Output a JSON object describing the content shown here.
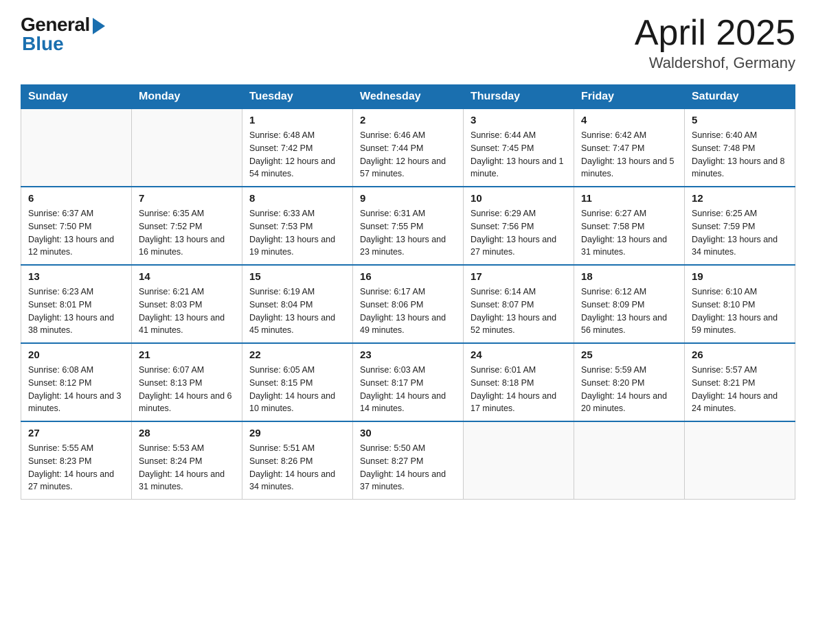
{
  "header": {
    "logo_general": "General",
    "logo_blue": "Blue",
    "title": "April 2025",
    "location": "Waldershof, Germany"
  },
  "weekdays": [
    "Sunday",
    "Monday",
    "Tuesday",
    "Wednesday",
    "Thursday",
    "Friday",
    "Saturday"
  ],
  "weeks": [
    [
      {
        "day": "",
        "sunrise": "",
        "sunset": "",
        "daylight": "",
        "empty": true
      },
      {
        "day": "",
        "sunrise": "",
        "sunset": "",
        "daylight": "",
        "empty": true
      },
      {
        "day": "1",
        "sunrise": "Sunrise: 6:48 AM",
        "sunset": "Sunset: 7:42 PM",
        "daylight": "Daylight: 12 hours and 54 minutes.",
        "empty": false
      },
      {
        "day": "2",
        "sunrise": "Sunrise: 6:46 AM",
        "sunset": "Sunset: 7:44 PM",
        "daylight": "Daylight: 12 hours and 57 minutes.",
        "empty": false
      },
      {
        "day": "3",
        "sunrise": "Sunrise: 6:44 AM",
        "sunset": "Sunset: 7:45 PM",
        "daylight": "Daylight: 13 hours and 1 minute.",
        "empty": false
      },
      {
        "day": "4",
        "sunrise": "Sunrise: 6:42 AM",
        "sunset": "Sunset: 7:47 PM",
        "daylight": "Daylight: 13 hours and 5 minutes.",
        "empty": false
      },
      {
        "day": "5",
        "sunrise": "Sunrise: 6:40 AM",
        "sunset": "Sunset: 7:48 PM",
        "daylight": "Daylight: 13 hours and 8 minutes.",
        "empty": false
      }
    ],
    [
      {
        "day": "6",
        "sunrise": "Sunrise: 6:37 AM",
        "sunset": "Sunset: 7:50 PM",
        "daylight": "Daylight: 13 hours and 12 minutes.",
        "empty": false
      },
      {
        "day": "7",
        "sunrise": "Sunrise: 6:35 AM",
        "sunset": "Sunset: 7:52 PM",
        "daylight": "Daylight: 13 hours and 16 minutes.",
        "empty": false
      },
      {
        "day": "8",
        "sunrise": "Sunrise: 6:33 AM",
        "sunset": "Sunset: 7:53 PM",
        "daylight": "Daylight: 13 hours and 19 minutes.",
        "empty": false
      },
      {
        "day": "9",
        "sunrise": "Sunrise: 6:31 AM",
        "sunset": "Sunset: 7:55 PM",
        "daylight": "Daylight: 13 hours and 23 minutes.",
        "empty": false
      },
      {
        "day": "10",
        "sunrise": "Sunrise: 6:29 AM",
        "sunset": "Sunset: 7:56 PM",
        "daylight": "Daylight: 13 hours and 27 minutes.",
        "empty": false
      },
      {
        "day": "11",
        "sunrise": "Sunrise: 6:27 AM",
        "sunset": "Sunset: 7:58 PM",
        "daylight": "Daylight: 13 hours and 31 minutes.",
        "empty": false
      },
      {
        "day": "12",
        "sunrise": "Sunrise: 6:25 AM",
        "sunset": "Sunset: 7:59 PM",
        "daylight": "Daylight: 13 hours and 34 minutes.",
        "empty": false
      }
    ],
    [
      {
        "day": "13",
        "sunrise": "Sunrise: 6:23 AM",
        "sunset": "Sunset: 8:01 PM",
        "daylight": "Daylight: 13 hours and 38 minutes.",
        "empty": false
      },
      {
        "day": "14",
        "sunrise": "Sunrise: 6:21 AM",
        "sunset": "Sunset: 8:03 PM",
        "daylight": "Daylight: 13 hours and 41 minutes.",
        "empty": false
      },
      {
        "day": "15",
        "sunrise": "Sunrise: 6:19 AM",
        "sunset": "Sunset: 8:04 PM",
        "daylight": "Daylight: 13 hours and 45 minutes.",
        "empty": false
      },
      {
        "day": "16",
        "sunrise": "Sunrise: 6:17 AM",
        "sunset": "Sunset: 8:06 PM",
        "daylight": "Daylight: 13 hours and 49 minutes.",
        "empty": false
      },
      {
        "day": "17",
        "sunrise": "Sunrise: 6:14 AM",
        "sunset": "Sunset: 8:07 PM",
        "daylight": "Daylight: 13 hours and 52 minutes.",
        "empty": false
      },
      {
        "day": "18",
        "sunrise": "Sunrise: 6:12 AM",
        "sunset": "Sunset: 8:09 PM",
        "daylight": "Daylight: 13 hours and 56 minutes.",
        "empty": false
      },
      {
        "day": "19",
        "sunrise": "Sunrise: 6:10 AM",
        "sunset": "Sunset: 8:10 PM",
        "daylight": "Daylight: 13 hours and 59 minutes.",
        "empty": false
      }
    ],
    [
      {
        "day": "20",
        "sunrise": "Sunrise: 6:08 AM",
        "sunset": "Sunset: 8:12 PM",
        "daylight": "Daylight: 14 hours and 3 minutes.",
        "empty": false
      },
      {
        "day": "21",
        "sunrise": "Sunrise: 6:07 AM",
        "sunset": "Sunset: 8:13 PM",
        "daylight": "Daylight: 14 hours and 6 minutes.",
        "empty": false
      },
      {
        "day": "22",
        "sunrise": "Sunrise: 6:05 AM",
        "sunset": "Sunset: 8:15 PM",
        "daylight": "Daylight: 14 hours and 10 minutes.",
        "empty": false
      },
      {
        "day": "23",
        "sunrise": "Sunrise: 6:03 AM",
        "sunset": "Sunset: 8:17 PM",
        "daylight": "Daylight: 14 hours and 14 minutes.",
        "empty": false
      },
      {
        "day": "24",
        "sunrise": "Sunrise: 6:01 AM",
        "sunset": "Sunset: 8:18 PM",
        "daylight": "Daylight: 14 hours and 17 minutes.",
        "empty": false
      },
      {
        "day": "25",
        "sunrise": "Sunrise: 5:59 AM",
        "sunset": "Sunset: 8:20 PM",
        "daylight": "Daylight: 14 hours and 20 minutes.",
        "empty": false
      },
      {
        "day": "26",
        "sunrise": "Sunrise: 5:57 AM",
        "sunset": "Sunset: 8:21 PM",
        "daylight": "Daylight: 14 hours and 24 minutes.",
        "empty": false
      }
    ],
    [
      {
        "day": "27",
        "sunrise": "Sunrise: 5:55 AM",
        "sunset": "Sunset: 8:23 PM",
        "daylight": "Daylight: 14 hours and 27 minutes.",
        "empty": false
      },
      {
        "day": "28",
        "sunrise": "Sunrise: 5:53 AM",
        "sunset": "Sunset: 8:24 PM",
        "daylight": "Daylight: 14 hours and 31 minutes.",
        "empty": false
      },
      {
        "day": "29",
        "sunrise": "Sunrise: 5:51 AM",
        "sunset": "Sunset: 8:26 PM",
        "daylight": "Daylight: 14 hours and 34 minutes.",
        "empty": false
      },
      {
        "day": "30",
        "sunrise": "Sunrise: 5:50 AM",
        "sunset": "Sunset: 8:27 PM",
        "daylight": "Daylight: 14 hours and 37 minutes.",
        "empty": false
      },
      {
        "day": "",
        "sunrise": "",
        "sunset": "",
        "daylight": "",
        "empty": true
      },
      {
        "day": "",
        "sunrise": "",
        "sunset": "",
        "daylight": "",
        "empty": true
      },
      {
        "day": "",
        "sunrise": "",
        "sunset": "",
        "daylight": "",
        "empty": true
      }
    ]
  ]
}
